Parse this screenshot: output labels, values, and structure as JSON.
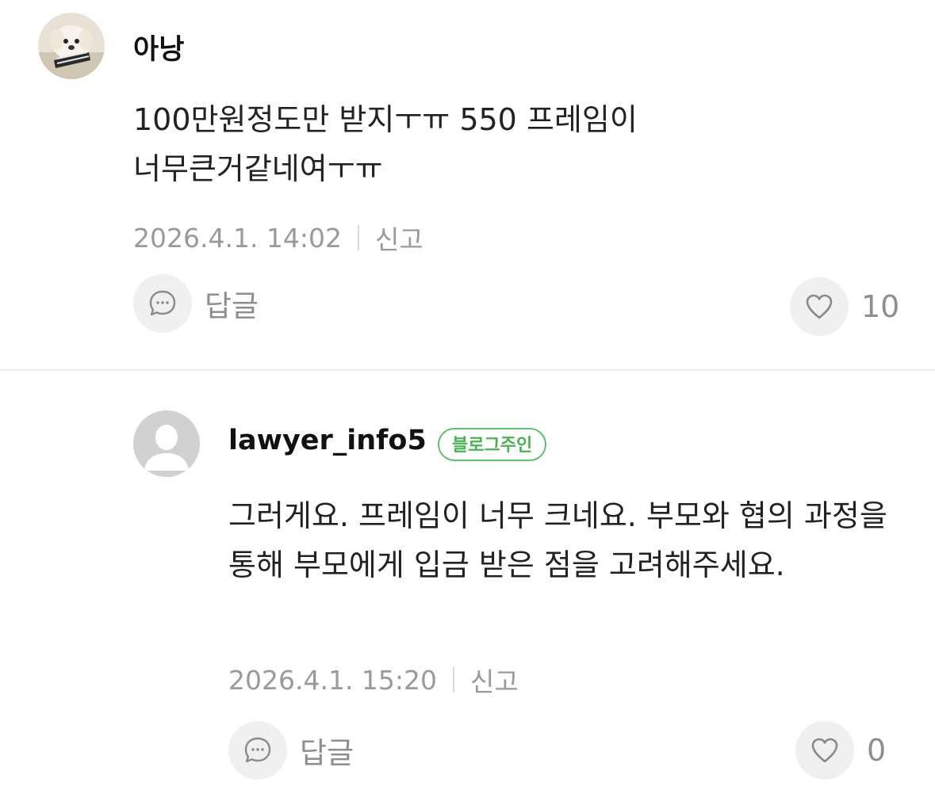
{
  "comments": [
    {
      "author": "아낭",
      "text": "100만원정도만 받지ㅜㅠ 550 프레임이 너무큰거같네여ㅜㅠ",
      "timestamp": "2026.4.1. 14:02",
      "report_label": "신고",
      "reply_label": "답글",
      "like_count": "10",
      "avatar_icon": "puppy-photo-avatar"
    },
    {
      "author": "lawyer_info5",
      "badge": "블로그주인",
      "text": "그러게요. 프레임이 너무 크네요. 부모와 협의 과정을 통해 부모에게 입금 받은 점을 고려해주세요.",
      "timestamp": "2026.4.1. 15:20",
      "report_label": "신고",
      "reply_label": "답글",
      "like_count": "0",
      "avatar_icon": "default-user-avatar"
    }
  ],
  "colors": {
    "badge_green": "#45b451",
    "meta_gray": "#9a9a9a",
    "button_bg": "#f0f0f0"
  }
}
